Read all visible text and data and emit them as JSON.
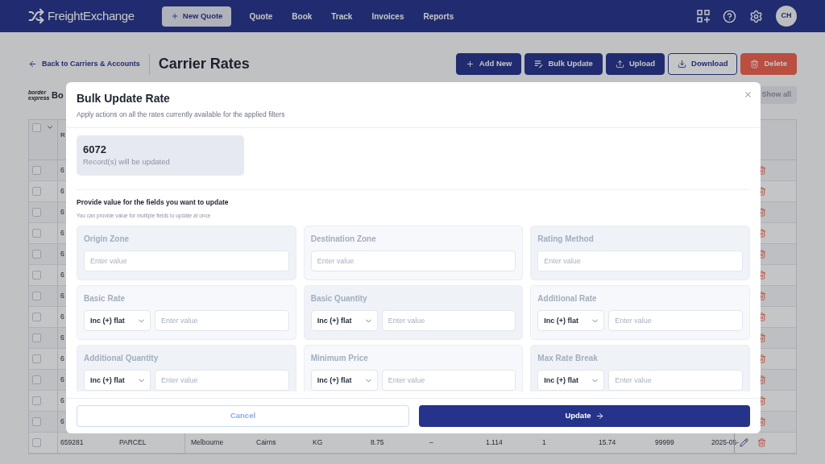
{
  "nav": {
    "brand": "FreightExchange",
    "new_quote": "New Quote",
    "items": [
      {
        "label": "Quote"
      },
      {
        "label": "Book"
      },
      {
        "label": "Track"
      },
      {
        "label": "Invoices"
      },
      {
        "label": "Reports"
      }
    ],
    "avatar": "CH"
  },
  "page": {
    "back": "Back to Carriers & Accounts",
    "title": "Carrier Rates",
    "actions": [
      {
        "kind": "add",
        "label": "Add New"
      },
      {
        "kind": "bulk",
        "label": "Bulk Update"
      },
      {
        "kind": "upload",
        "label": "Upload"
      },
      {
        "kind": "download",
        "label": "Download"
      },
      {
        "kind": "delete",
        "label": "Delete"
      }
    ],
    "carrier_logo": "border express",
    "carrier_name": "Bo",
    "show_all": "Show all"
  },
  "table": {
    "all_checked": false,
    "columns": [
      {
        "label": "R"
      }
    ],
    "rows": [
      {
        "checked": false,
        "cells": [
          "6"
        ]
      },
      {
        "checked": false,
        "cells": [
          "6"
        ]
      },
      {
        "checked": false,
        "cells": [
          "6"
        ]
      },
      {
        "checked": false,
        "cells": [
          "6"
        ]
      },
      {
        "checked": false,
        "cells": [
          "6"
        ]
      },
      {
        "checked": false,
        "cells": [
          "6"
        ]
      },
      {
        "checked": false,
        "cells": [
          "6"
        ]
      },
      {
        "checked": false,
        "cells": [
          "6"
        ]
      },
      {
        "checked": false,
        "cells": [
          "6"
        ]
      },
      {
        "checked": false,
        "cells": [
          "6"
        ]
      },
      {
        "checked": false,
        "cells": [
          "6"
        ]
      },
      {
        "checked": false,
        "cells": [
          "6"
        ]
      },
      {
        "checked": false,
        "cells": [
          "6"
        ]
      },
      {
        "checked": false,
        "cells": [
          "659281",
          "PARCEL",
          "Melbourne",
          "Cairns",
          "KG",
          "8.75",
          "–",
          "1.114",
          "1",
          "15.74",
          "99999",
          "2025-05-"
        ]
      }
    ]
  },
  "modal": {
    "title": "Bulk Update Rate",
    "subtitle": "Apply actions on all the rates currently available for the applied filters",
    "count": "6072",
    "count_label": "Record(s) will be updated",
    "section_title": "Provide value for the fields you want to update",
    "section_hint": "You can provide value for multiple fields to update at once",
    "fields": [
      {
        "kind": "text",
        "label": "Origin Zone",
        "placeholder": "Enter value"
      },
      {
        "kind": "text",
        "label": "Destination Zone",
        "placeholder": "Enter value"
      },
      {
        "kind": "text",
        "label": "Rating Method",
        "placeholder": "Enter value"
      },
      {
        "kind": "adjust",
        "label": "Basic Rate",
        "operator": "Inc (+) flat",
        "placeholder": "Enter value"
      },
      {
        "kind": "adjust",
        "label": "Basic Quantity",
        "operator": "Inc (+) flat",
        "placeholder": "Enter value"
      },
      {
        "kind": "adjust",
        "label": "Additional Rate",
        "operator": "Inc (+) flat",
        "placeholder": "Enter value"
      },
      {
        "kind": "adjust",
        "label": "Additional Quantity",
        "operator": "Inc (+) flat",
        "placeholder": "Enter value"
      },
      {
        "kind": "adjust",
        "label": "Minimum Price",
        "operator": "Inc (+) flat",
        "placeholder": "Enter value"
      },
      {
        "kind": "adjust",
        "label": "Max Rate Break",
        "operator": "Inc (+) flat",
        "placeholder": "Enter value"
      }
    ],
    "cancel": "Cancel",
    "submit": "Update"
  }
}
